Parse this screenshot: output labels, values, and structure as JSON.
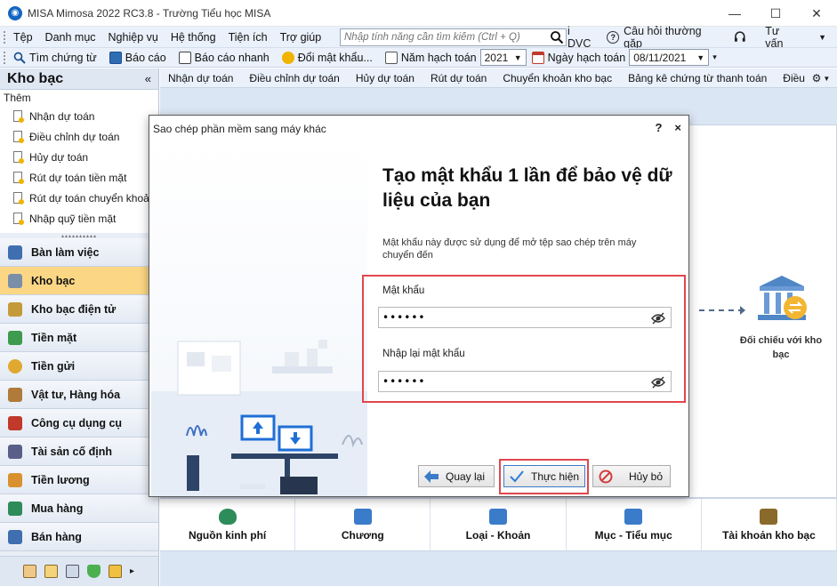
{
  "window": {
    "title": "MISA Mimosa 2022 RC3.8 - Trường Tiểu học MISA",
    "controls": [
      "minimize",
      "maximize",
      "close"
    ]
  },
  "menubar": {
    "items": [
      "Tệp",
      "Danh mục",
      "Nghiệp vụ",
      "Hệ thống",
      "Tiện ích",
      "Trợ giúp"
    ],
    "search_placeholder": "Nhập tính năng cần tìm kiếm (Ctrl + Q)",
    "dvc_label": "i DVC",
    "faq_label": "Câu hỏi thường gặp",
    "consult_label": "Tư vấn"
  },
  "toolbar": {
    "find_voucher": "Tìm chứng từ",
    "report": "Báo cáo",
    "quick_report": "Báo cáo nhanh",
    "change_password": "Đổi mật khẩu...",
    "fiscal_year_label": "Năm hạch toán",
    "fiscal_year_value": "2021",
    "posting_date_label": "Ngày hạch toán",
    "posting_date_value": "08/11/2021"
  },
  "left_panel": {
    "title": "Kho bạc",
    "collapse_icon": "double-chevron-left-icon",
    "add_label": "Thêm",
    "tasks": [
      "Nhận dự toán",
      "Điều chỉnh dự toán",
      "Hủy dự toán",
      "Rút dự toán tiền mặt",
      "Rút dự toán chuyển khoản",
      "Nhập quỹ tiền mặt"
    ],
    "nav": [
      "Bàn làm việc",
      "Kho bạc",
      "Kho bạc điện tử",
      "Tiền mặt",
      "Tiền gửi",
      "Vật tư, Hàng hóa",
      "Công cụ dụng cụ",
      "Tài sản cố định",
      "Tiền lương",
      "Mua hàng",
      "Bán hàng"
    ],
    "active_nav": "Kho bạc"
  },
  "tabs": [
    "Nhận dự toán",
    "Điều chỉnh dự toán",
    "Hủy dự toán",
    "Rút dự toán",
    "Chuyển khoản kho bạc",
    "Bảng kê chứng từ thanh toán",
    "Điều chỉnh kinh"
  ],
  "flow": {
    "node_label": "Đối chiếu với kho bạc"
  },
  "bottom_cards": [
    "Nguồn kinh phí",
    "Chương",
    "Loại - Khoản",
    "Mục - Tiểu mục",
    "Tài khoản kho bạc"
  ],
  "dialog": {
    "title": "Sao chép phần mềm sang máy khác",
    "help": "?",
    "close": "×",
    "heading": "Tạo mật khẩu 1 lần để bảo vệ dữ liệu của bạn",
    "description": "Mật khẩu này được sử dụng để mở tệp sao chép trên máy chuyển đến",
    "password_label": "Mật khẩu",
    "password_value": "••••••",
    "confirm_label": "Nhập lại mật khẩu",
    "confirm_value": "••••••",
    "back_button": "Quay lại",
    "execute_button": "Thực hiện",
    "cancel_button": "Hủy bỏ"
  },
  "colors": {
    "accent_blue": "#1565c0",
    "active_nav": "#fbd785",
    "highlight_red": "#e0474c",
    "panel_bg": "#e9eef6"
  }
}
